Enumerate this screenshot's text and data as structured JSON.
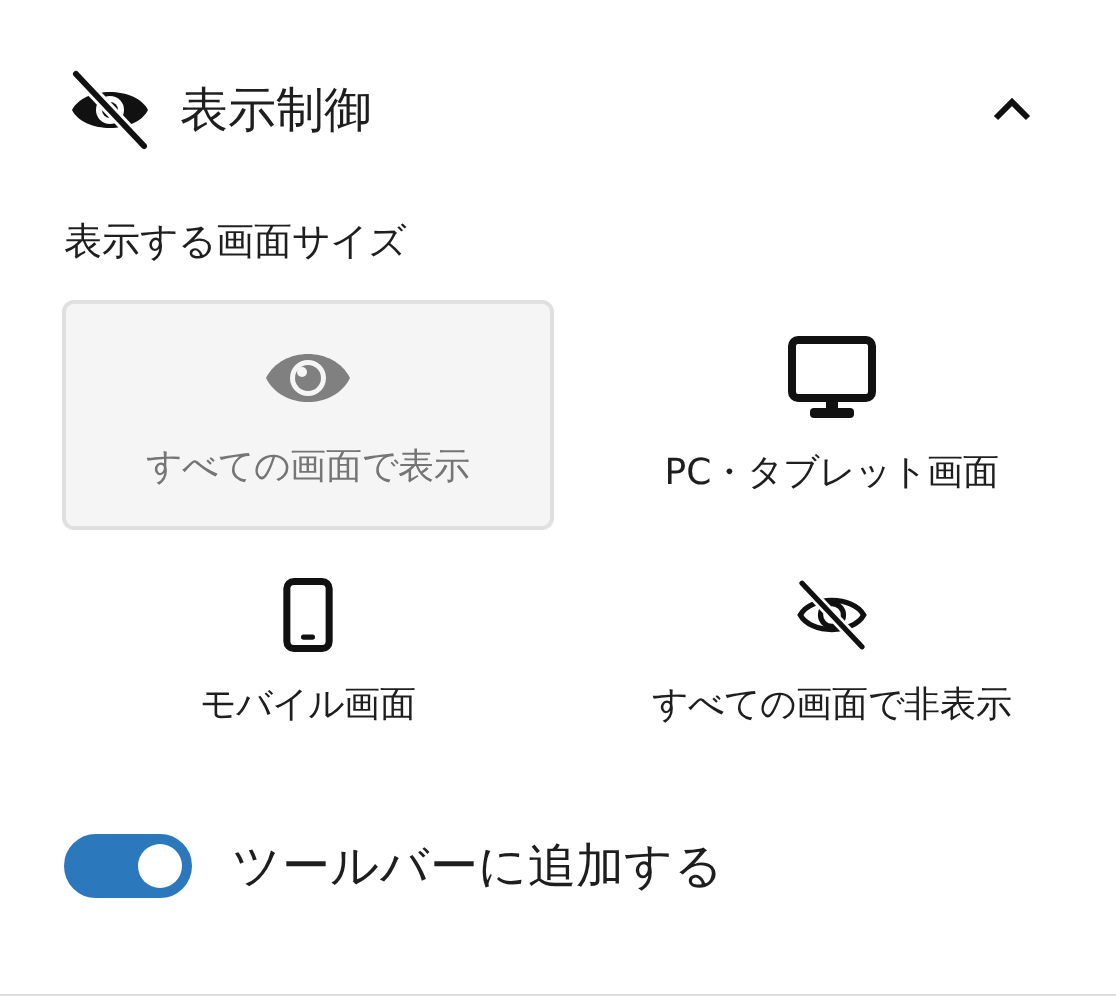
{
  "panel": {
    "title": "表示制御",
    "expanded": true
  },
  "screen_size": {
    "label": "表示する画面サイズ",
    "options": [
      {
        "kind": "all",
        "label": "すべての画面で表示",
        "selected": true
      },
      {
        "kind": "desktop",
        "label": "PC・タブレット画面",
        "selected": false
      },
      {
        "kind": "mobile",
        "label": "モバイル画面",
        "selected": false
      },
      {
        "kind": "hidden",
        "label": "すべての画面で非表示",
        "selected": false
      }
    ]
  },
  "toolbar_toggle": {
    "label": "ツールバーに追加する",
    "on": true
  }
}
